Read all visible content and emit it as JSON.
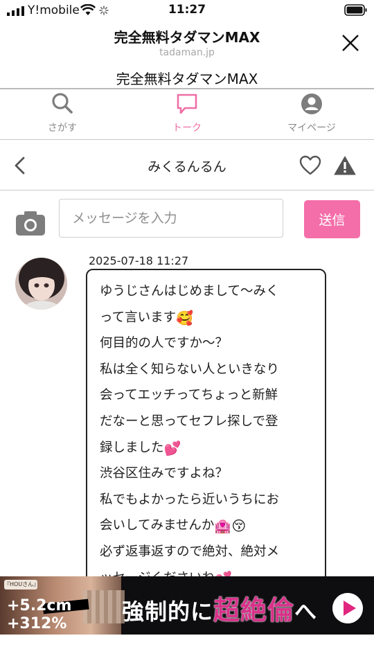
{
  "status_bar": {
    "carrier": "Y!mobile",
    "time": "11:27"
  },
  "browser": {
    "page_title": "完全無料タダマンMAX",
    "domain": "tadaman.jp"
  },
  "site": {
    "title": "完全無料タダマンMAX"
  },
  "nav": {
    "items": [
      {
        "label": "さがす",
        "icon": "search-icon",
        "active": false
      },
      {
        "label": "トーク",
        "icon": "chat-bubble-icon",
        "active": true
      },
      {
        "label": "マイページ",
        "icon": "user-icon",
        "active": false
      }
    ],
    "active_color": "#ef6fa5"
  },
  "chat": {
    "partner_name": "みくるんるん"
  },
  "composer": {
    "placeholder": "メッセージを入力",
    "send_label": "送信",
    "send_color": "#f46ea9"
  },
  "message": {
    "timestamp": "2025-07-18 11:27",
    "lines": [
      "ゆうじさんはじめまして〜みく",
      "って言います",
      "何目的の人ですか〜？",
      "私は全く知らない人といきなり",
      "会ってエッチってちょっと新鮮",
      "だなーと思ってセフレ探しで登",
      "録しました",
      "渋谷区住みですよね？",
      "私でもよかったら近いうちにお",
      "会いしてみませんか",
      "必ず返事返すので絶対、絶対メ",
      "ッセージくださいね"
    ],
    "emoji": [
      "🥰",
      "💕",
      "🏩",
      "😚",
      "💕"
    ]
  },
  "ad": {
    "badge": "『HOUさん』",
    "stat1": "+5.2cm",
    "stat2": "+312%",
    "text_pre": "強制的に",
    "text_highlight": "超絶倫",
    "text_post": "へ"
  }
}
